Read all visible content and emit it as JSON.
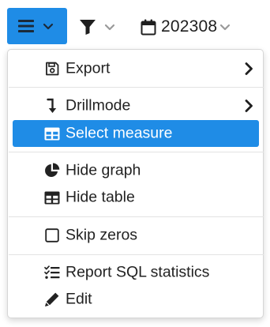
{
  "toolbar": {
    "menu_icon": "bars-icon",
    "filter_icon": "filter-icon",
    "date_icon": "calendar-icon",
    "date_label": "202308",
    "accent_color": "#1f8ce6"
  },
  "menu": {
    "items": [
      {
        "label": "Export",
        "icon": "save-icon",
        "submenu": true
      },
      {
        "label": "Drillmode",
        "icon": "level-down-icon",
        "submenu": true
      },
      {
        "label": "Select measure",
        "icon": "table-icon",
        "active": true
      },
      {
        "label": "Hide graph",
        "icon": "pie-chart-icon"
      },
      {
        "label": "Hide table",
        "icon": "table-icon"
      },
      {
        "label": "Skip zeros",
        "icon": "checkbox-icon"
      },
      {
        "label": "Report SQL statistics",
        "icon": "tasks-icon"
      },
      {
        "label": "Edit",
        "icon": "pencil-icon"
      }
    ]
  }
}
